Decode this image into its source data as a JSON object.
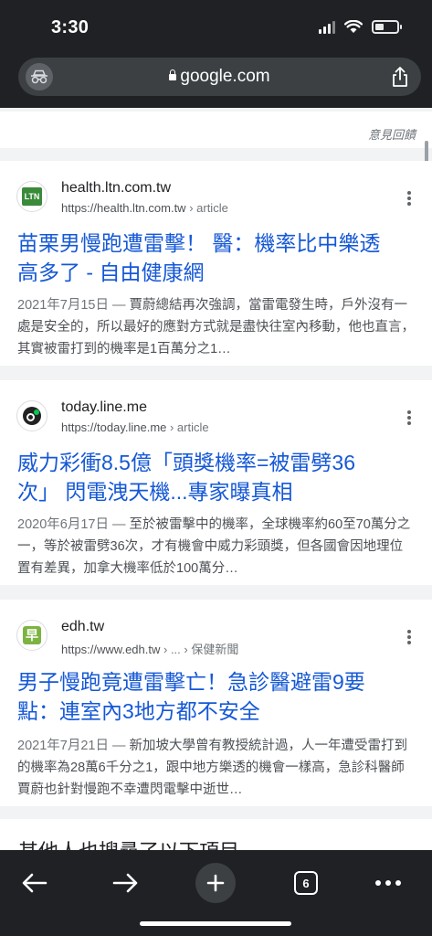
{
  "status": {
    "time": "3:30"
  },
  "address_bar": {
    "url": "google.com"
  },
  "feedback_label": "意見回饋",
  "results": [
    {
      "site": "health.ltn.com.tw",
      "url": "https://health.ltn.com.tw",
      "url_suffix": " › article",
      "title_line1": "苗栗男慢跑遭雷擊！ 醫：機率比中樂透",
      "title_line2": "高多了 - 自由健康網",
      "date": "2021年7月15日 — ",
      "snippet": "賈蔚總結再次強調，當雷電發生時，戶外沒有一處是安全的，所以最好的應對方式就是盡快往室內移動，他也直言，其實被雷打到的機率是1百萬分之1…",
      "favicon": "ltn-logo-icon"
    },
    {
      "site": "today.line.me",
      "url": "https://today.line.me",
      "url_suffix": " › article",
      "title_line1": "威力彩衝8.5億「頭獎機率=被雷劈36",
      "title_line2": "次」 閃電洩天機...專家曝真相",
      "date": "2020年6月17日 — ",
      "snippet": "至於被雷擊中的機率，全球機率約60至70萬分之一，等於被雷劈36次，才有機會中威力彩頭獎，但各國會因地理位置有差異，加拿大機率低於100萬分…",
      "favicon": "line-today-icon"
    },
    {
      "site": "edh.tw",
      "url": "https://www.edh.tw",
      "url_suffix": " › ... › 保健新聞",
      "title_line1": "男子慢跑竟遭雷擊亡！急診醫避雷9要",
      "title_line2": "點：連室內3地方都不安全",
      "date": "2021年7月21日 — ",
      "snippet": "新加坡大學曾有教授統計過，人一年遭受雷打到的機率為28萬6千分之1，跟中地方樂透的機會一樣高，急診科醫師賈蔚也針對慢跑不幸遭閃電擊中逝世…",
      "favicon": "edh-logo-icon"
    }
  ],
  "next_section_title": "其他人也搜尋了以下項目",
  "toolbar": {
    "tab_count": "6"
  },
  "colors": {
    "chrome": "#202124",
    "link": "#1558d6",
    "snippet": "#4d5156"
  }
}
